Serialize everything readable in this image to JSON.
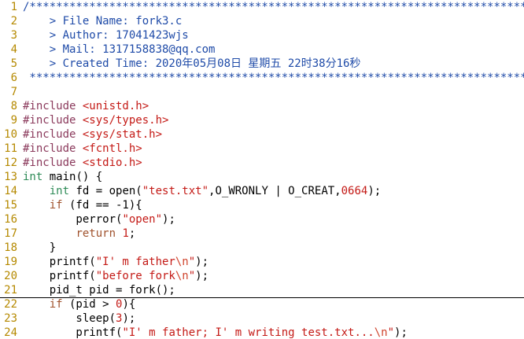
{
  "editor": {
    "lines": [
      {
        "num": "1",
        "segs": [
          {
            "t": "/****************************************************************************",
            "k": "c"
          }
        ]
      },
      {
        "num": "2",
        "segs": [
          {
            "t": "    > File Name: fork3.c",
            "k": "c"
          }
        ]
      },
      {
        "num": "3",
        "segs": [
          {
            "t": "    > Author: 17041423wjs",
            "k": "c"
          }
        ]
      },
      {
        "num": "4",
        "segs": [
          {
            "t": "    > Mail: 1317158838@qq.com",
            "k": "c"
          }
        ]
      },
      {
        "num": "5",
        "segs": [
          {
            "t": "    > Created Time: 2020年05月08日 星期五 22时38分16秒",
            "k": "c"
          }
        ]
      },
      {
        "num": "6",
        "segs": [
          {
            "t": " ****************************************************************************",
            "k": "c"
          }
        ]
      },
      {
        "num": "7",
        "segs": []
      },
      {
        "num": "8",
        "segs": [
          {
            "t": "#include ",
            "k": "pp"
          },
          {
            "t": "<unistd.h>",
            "k": "s"
          }
        ]
      },
      {
        "num": "9",
        "segs": [
          {
            "t": "#include ",
            "k": "pp"
          },
          {
            "t": "<sys/types.h>",
            "k": "s"
          }
        ]
      },
      {
        "num": "10",
        "segs": [
          {
            "t": "#include ",
            "k": "pp"
          },
          {
            "t": "<sys/stat.h>",
            "k": "s"
          }
        ]
      },
      {
        "num": "11",
        "segs": [
          {
            "t": "#include ",
            "k": "pp"
          },
          {
            "t": "<fcntl.h>",
            "k": "s"
          }
        ]
      },
      {
        "num": "12",
        "segs": [
          {
            "t": "#include ",
            "k": "pp"
          },
          {
            "t": "<stdio.h>",
            "k": "s"
          }
        ]
      },
      {
        "num": "13",
        "segs": [
          {
            "t": "int",
            "k": "ty"
          },
          {
            "t": " main() {",
            "k": "pl"
          }
        ]
      },
      {
        "num": "14",
        "segs": [
          {
            "t": "    ",
            "k": "pl"
          },
          {
            "t": "int",
            "k": "ty"
          },
          {
            "t": " fd = open(",
            "k": "pl"
          },
          {
            "t": "\"test.txt\"",
            "k": "s"
          },
          {
            "t": ",O_WRONLY | O_CREAT,",
            "k": "pl"
          },
          {
            "t": "0664",
            "k": "n"
          },
          {
            "t": ");",
            "k": "pl"
          }
        ]
      },
      {
        "num": "15",
        "segs": [
          {
            "t": "    ",
            "k": "pl"
          },
          {
            "t": "if",
            "k": "kw"
          },
          {
            "t": " (fd == -1){",
            "k": "pl"
          }
        ]
      },
      {
        "num": "16",
        "segs": [
          {
            "t": "        perror(",
            "k": "pl"
          },
          {
            "t": "\"open\"",
            "k": "s"
          },
          {
            "t": ");",
            "k": "pl"
          }
        ]
      },
      {
        "num": "17",
        "segs": [
          {
            "t": "        ",
            "k": "pl"
          },
          {
            "t": "return",
            "k": "kw"
          },
          {
            "t": " ",
            "k": "pl"
          },
          {
            "t": "1",
            "k": "n"
          },
          {
            "t": ";",
            "k": "pl"
          }
        ]
      },
      {
        "num": "18",
        "segs": [
          {
            "t": "    }",
            "k": "pl"
          }
        ]
      },
      {
        "num": "19",
        "segs": [
          {
            "t": "    printf(",
            "k": "pl"
          },
          {
            "t": "\"I' m father",
            "k": "s"
          },
          {
            "t": "\\n",
            "k": "sp"
          },
          {
            "t": "\"",
            "k": "s"
          },
          {
            "t": ");",
            "k": "pl"
          }
        ]
      },
      {
        "num": "20",
        "segs": [
          {
            "t": "    printf(",
            "k": "pl"
          },
          {
            "t": "\"before fork",
            "k": "s"
          },
          {
            "t": "\\n",
            "k": "sp"
          },
          {
            "t": "\"",
            "k": "s"
          },
          {
            "t": ");",
            "k": "pl"
          }
        ]
      },
      {
        "num": "21",
        "cursor": true,
        "segs": [
          {
            "t": "    pid_t pid = fork();",
            "k": "pl"
          }
        ]
      },
      {
        "num": "22",
        "segs": [
          {
            "t": "    ",
            "k": "pl"
          },
          {
            "t": "if",
            "k": "kw"
          },
          {
            "t": " (pid > ",
            "k": "pl"
          },
          {
            "t": "0",
            "k": "n"
          },
          {
            "t": "){",
            "k": "pl"
          }
        ]
      },
      {
        "num": "23",
        "segs": [
          {
            "t": "        sleep(",
            "k": "pl"
          },
          {
            "t": "3",
            "k": "n"
          },
          {
            "t": ");",
            "k": "pl"
          }
        ]
      },
      {
        "num": "24",
        "segs": [
          {
            "t": "        printf(",
            "k": "pl"
          },
          {
            "t": "\"I' m father; I' m writing test.txt...",
            "k": "s"
          },
          {
            "t": "\\n",
            "k": "sp"
          },
          {
            "t": "\"",
            "k": "s"
          },
          {
            "t": ");",
            "k": "pl"
          }
        ]
      }
    ]
  },
  "colors": {
    "comment": "#1f4ba8",
    "preproc": "#8b3a5c",
    "type": "#2e8b57",
    "keyword": "#a0522d",
    "string": "#c41a16",
    "line_number": "#b58900"
  }
}
